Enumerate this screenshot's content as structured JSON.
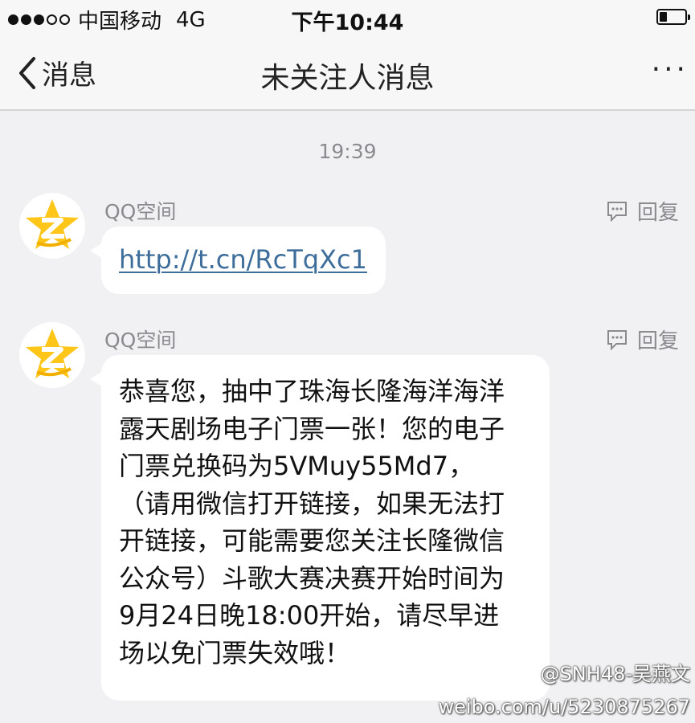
{
  "status_bar": {
    "carrier": "中国移动",
    "network": "4G",
    "time": "下午10:44",
    "signal_bars": 3,
    "signal_total": 5,
    "battery_level": 0.3
  },
  "nav": {
    "back_label": "消息",
    "title": "未关注人消息",
    "more_label": "···"
  },
  "timestamp": "19:39",
  "messages": [
    {
      "sender": "QQ空间",
      "reply_label": "回复",
      "link": "http://t.cn/RcTqXc1"
    },
    {
      "sender": "QQ空间",
      "reply_label": "回复",
      "text": "恭喜您，抽中了珠海长隆海洋海洋\n露天剧场电子门票一张！您的电子\n门票兑换码为5VMuy55Md7，\n（请用微信打开链接，如果无法打\n开链接，可能需要您关注长隆微信\n公众号）斗歌大赛决赛开始时间为\n9月24日晚18:00开始，请尽早进\n场以免门票失效哦！"
    }
  ],
  "watermark": {
    "handle": "@SNH48-吴燕文",
    "url": "weibo.com/u/5230875267"
  }
}
